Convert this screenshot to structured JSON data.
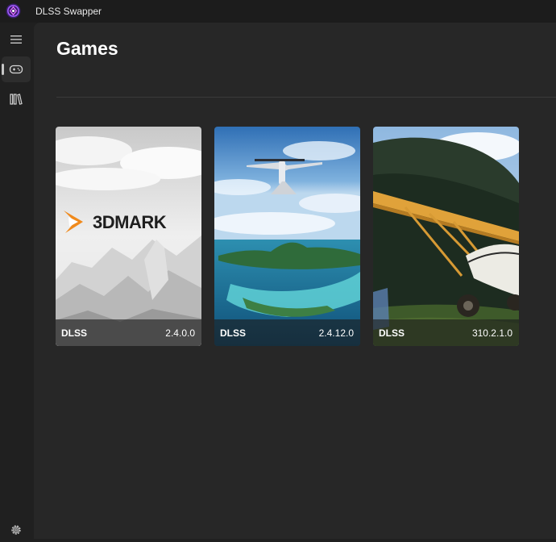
{
  "window": {
    "title": "DLSS Swapper",
    "logo_icon": "dlss-swapper-logo",
    "accent": "#7b3fe4"
  },
  "nav": {
    "items": [
      {
        "id": "menu",
        "icon": "hamburger-menu-icon"
      },
      {
        "id": "games",
        "icon": "gamepad-icon",
        "selected": true
      },
      {
        "id": "library",
        "icon": "library-icon"
      },
      {
        "id": "settings",
        "icon": "gear-icon"
      }
    ]
  },
  "page": {
    "title": "Games"
  },
  "games": [
    {
      "art_text": "3DMARK",
      "tech": "DLSS",
      "version": "2.4.0.0"
    },
    {
      "art_text": "",
      "tech": "DLSS",
      "version": "2.4.12.0"
    },
    {
      "art_text": "",
      "tech": "DLSS",
      "version": "310.2.1.0"
    }
  ]
}
